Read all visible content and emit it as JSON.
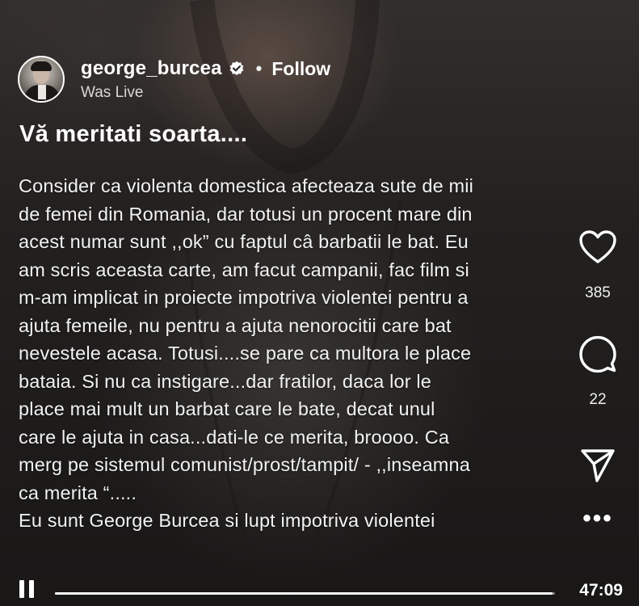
{
  "post": {
    "username": "george_burcea",
    "separator": "•",
    "follow_label": "Follow",
    "status": "Was Live",
    "title": "Vă meritati soarta....",
    "caption_lines": [
      "Consider ca violenta domestica afecteaza sute de mii",
      "de femei din Romania, dar totusi un procent mare din",
      "acest numar sunt ,,ok” cu faptul câ barbatii le bat. Eu",
      "am scris aceasta carte, am facut campanii, fac film si",
      "m-am implicat in proiecte impotriva violentei pentru a",
      "ajuta femeile, nu pentru a ajuta nenorocitii care bat",
      "nevestele acasa. Totusi....se pare ca multora le place",
      "bataia. Si  nu ca instigare...dar fratilor, daca lor le",
      "place mai mult un barbat care le bate, decat unul",
      "care le ajuta in casa...dati-le ce merita, broooo. Ca",
      "merg pe sistemul comunist/prost/tampit/ - ,,inseamna",
      "ca merita “.....",
      "Eu sunt George Burcea si lupt impotriva violentei"
    ]
  },
  "actions": {
    "like_icon": "heart-icon",
    "likes": "385",
    "comment_icon": "comment-bubble-icon",
    "comments": "22",
    "share_icon": "paper-plane-icon",
    "more_icon": "more-dots-icon",
    "more_label": "•••"
  },
  "player": {
    "pause_icon": "pause-icon",
    "elapsed_fraction": 0.995,
    "time": "47:09"
  },
  "colors": {
    "text": "#ffffff",
    "verified_badge": "#ffffff",
    "progress_track": "#9a9896"
  }
}
